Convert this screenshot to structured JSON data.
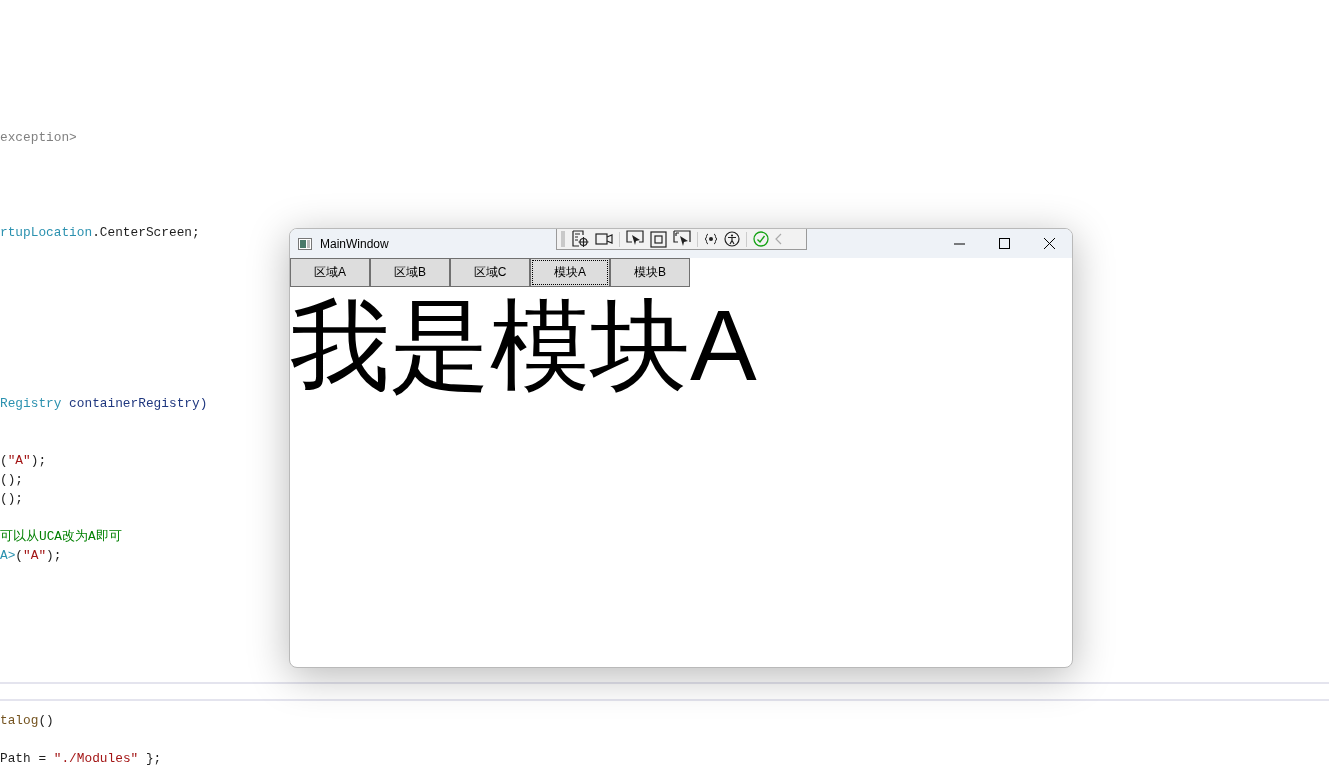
{
  "editor": {
    "top_lines": [
      {
        "segments": [
          {
            "text": "exception>",
            "kind": "muted"
          }
        ]
      },
      {
        "segments": [
          {
            "text": "rtupLocation",
            "kind": "type"
          },
          {
            "text": ".CenterScreen;",
            "kind": "plain"
          }
        ]
      },
      {
        "segments": [
          {
            "text": "Registry",
            "kind": "type"
          },
          {
            "text": " containerRegistry)",
            "kind": "ident"
          }
        ]
      },
      {
        "segments": [
          {
            "text": "(",
            "kind": "plain"
          },
          {
            "text": "\"A\"",
            "kind": "string"
          },
          {
            "text": ");",
            "kind": "plain"
          }
        ]
      },
      {
        "segments": [
          {
            "text": "();",
            "kind": "plain"
          }
        ]
      },
      {
        "segments": [
          {
            "text": "();",
            "kind": "plain"
          }
        ]
      },
      {
        "segments": [
          {
            "text": "可以从UCA改为A即可",
            "kind": "comment"
          }
        ]
      },
      {
        "segments": [
          {
            "text": "A>",
            "kind": "type"
          },
          {
            "text": "(",
            "kind": "plain"
          },
          {
            "text": "\"A\"",
            "kind": "string"
          },
          {
            "text": ");",
            "kind": "plain"
          }
        ]
      }
    ],
    "bottom_lines": [
      {
        "segments": [
          {
            "text": "talog",
            "kind": "method"
          },
          {
            "text": "()",
            "kind": "plain"
          }
        ]
      },
      {
        "segments": [
          {
            "text": "Path = ",
            "kind": "plain"
          },
          {
            "text": "\"./Modules\"",
            "kind": "string"
          },
          {
            "text": " };",
            "kind": "plain"
          }
        ]
      }
    ]
  },
  "window": {
    "title": "MainWindow",
    "buttons": [
      {
        "label": "区域A",
        "focused": false
      },
      {
        "label": "区域B",
        "focused": false
      },
      {
        "label": "区域C",
        "focused": false
      },
      {
        "label": "模块A",
        "focused": true
      },
      {
        "label": "模块B",
        "focused": false
      }
    ],
    "content": "我是模块A"
  }
}
